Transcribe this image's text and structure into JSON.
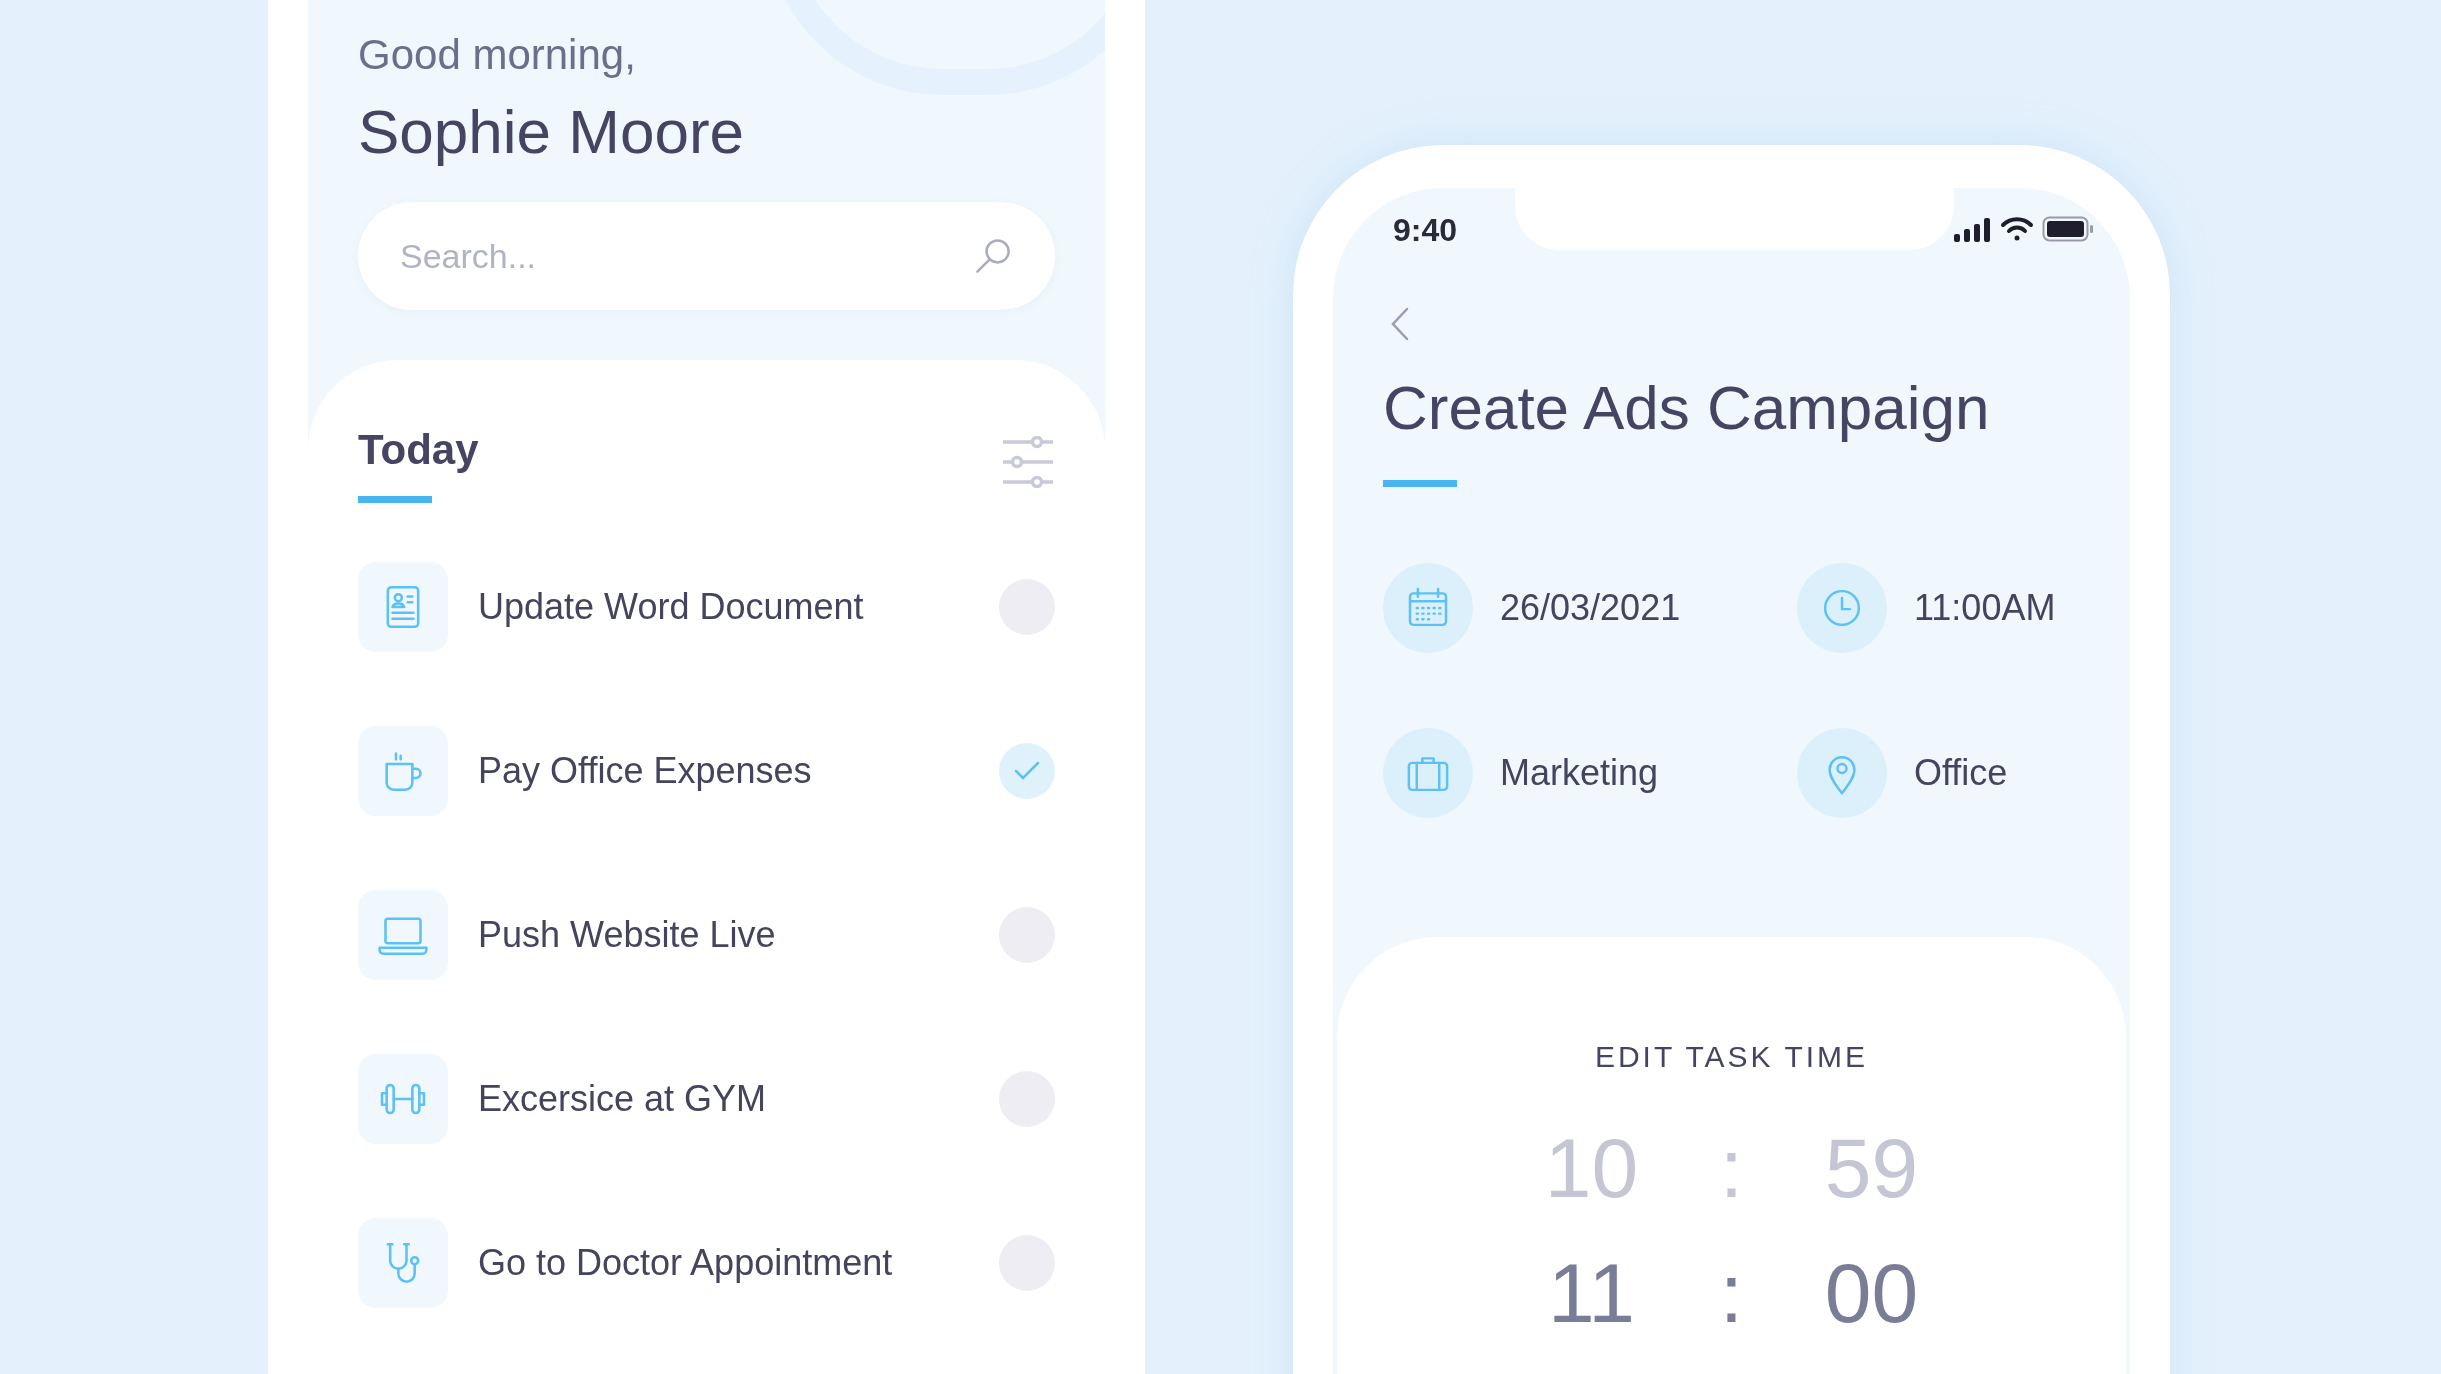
{
  "home": {
    "greeting": "Good morning,",
    "user_name": "Sophie Moore",
    "search": {
      "placeholder": "Search..."
    },
    "section_title": "Today",
    "tasks": [
      {
        "label": "Update Word Document",
        "done": false
      },
      {
        "label": "Pay Office Expenses",
        "done": true
      },
      {
        "label": "Push Website Live",
        "done": false
      },
      {
        "label": "Excersice at GYM",
        "done": false
      },
      {
        "label": "Go to Doctor Appointment",
        "done": false
      }
    ]
  },
  "detail": {
    "status_bar": {
      "time": "9:40"
    },
    "title": "Create Ads Campaign",
    "fields": [
      {
        "kind": "date",
        "value": "26/03/2021"
      },
      {
        "kind": "time",
        "value": "11:00AM"
      },
      {
        "kind": "category",
        "value": "Marketing"
      },
      {
        "kind": "location",
        "value": "Office"
      }
    ],
    "time_picker": {
      "title": "EDIT TASK TIME",
      "rows": [
        {
          "hours": "10",
          "separator": ":",
          "minutes": "59",
          "selected": false
        },
        {
          "hours": "11",
          "separator": ":",
          "minutes": "00",
          "selected": true
        }
      ]
    }
  }
}
